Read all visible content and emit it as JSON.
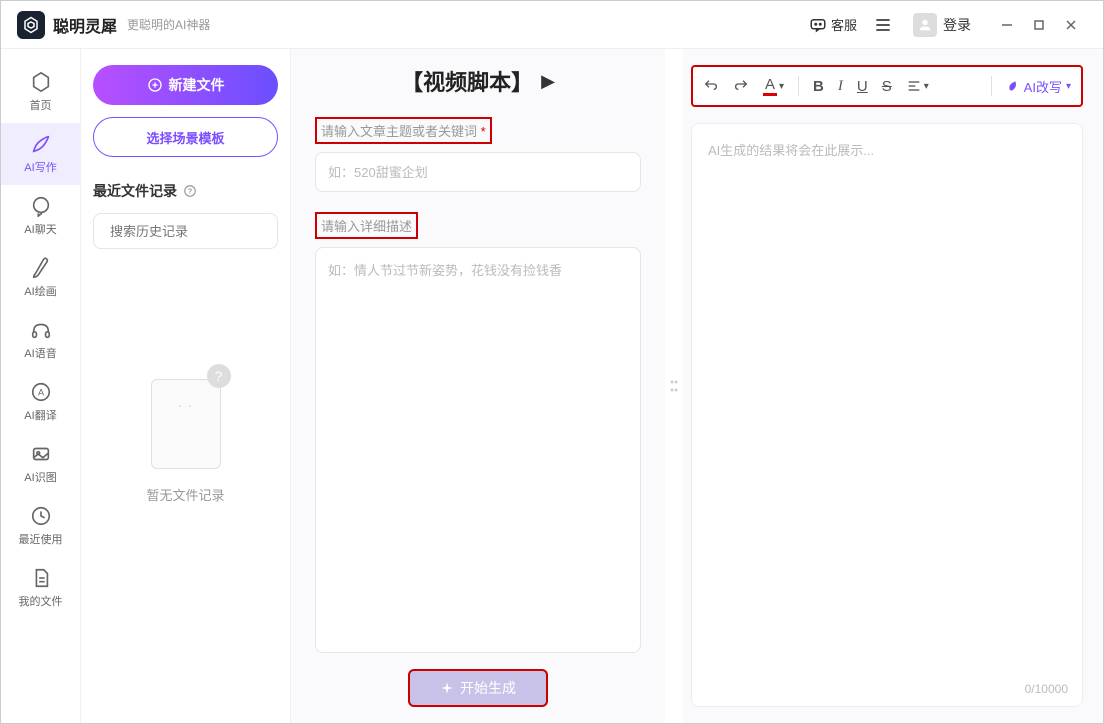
{
  "titlebar": {
    "app_name": "聪明灵犀",
    "subtitle": "更聪明的AI神器",
    "kefu_label": "客服",
    "login_label": "登录"
  },
  "sidebar": {
    "items": [
      {
        "label": "首页",
        "icon": "home"
      },
      {
        "label": "AI写作",
        "icon": "pen"
      },
      {
        "label": "AI聊天",
        "icon": "chat"
      },
      {
        "label": "AI绘画",
        "icon": "brush"
      },
      {
        "label": "AI语音",
        "icon": "headphones"
      },
      {
        "label": "AI翻译",
        "icon": "translate"
      },
      {
        "label": "AI识图",
        "icon": "image"
      },
      {
        "label": "最近使用",
        "icon": "clock"
      },
      {
        "label": "我的文件",
        "icon": "file"
      }
    ]
  },
  "file_panel": {
    "new_file": "新建文件",
    "template": "选择场景模板",
    "recent_title": "最近文件记录",
    "search_placeholder": "搜索历史记录",
    "empty": "暂无文件记录"
  },
  "center": {
    "title": "【视频脚本】",
    "topic_label": "请输入文章主题或者关键词",
    "topic_placeholder": "如：520甜蜜企划",
    "desc_label": "请输入详细描述",
    "desc_placeholder": "如：情人节过节新姿势，花钱没有捡钱香",
    "generate": "开始生成"
  },
  "right": {
    "ai_rewrite": "AI改写",
    "output_placeholder": "AI生成的结果将会在此展示...",
    "char_count": "0/10000"
  },
  "toolbar": {
    "text_color": "A",
    "bold": "B",
    "italic": "I",
    "underline": "U",
    "strike": "S"
  }
}
